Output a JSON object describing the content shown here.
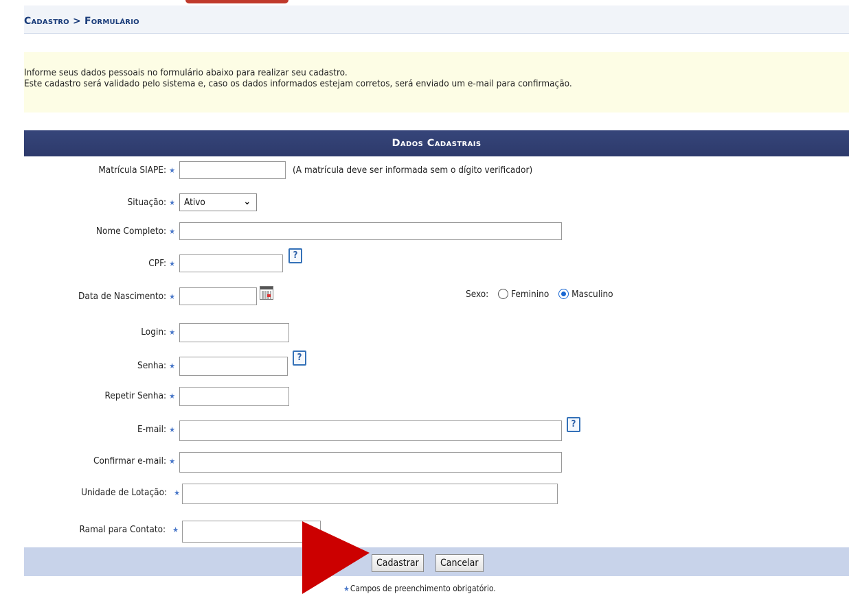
{
  "breadcrumb": "Cadastro > Formulário",
  "notice": {
    "line1": "Informe seus dados pessoais no formulário abaixo para realizar seu cadastro.",
    "line2": "Este cadastro será validado pelo sistema e, caso os dados informados estejam corretos, será enviado um e-mail para confirmação."
  },
  "form": {
    "title": "Dados Cadastrais",
    "required_marker": "★",
    "fields": {
      "matricula": {
        "label": "Matrícula SIAPE:",
        "value": "",
        "hint": "(A matrícula deve ser informada sem o dígito verificador)"
      },
      "situacao": {
        "label": "Situação:",
        "selected": "Ativo"
      },
      "nome": {
        "label": "Nome Completo:",
        "value": ""
      },
      "cpf": {
        "label": "CPF:",
        "value": ""
      },
      "nascimento": {
        "label": "Data de Nascimento:",
        "value": ""
      },
      "sexo": {
        "label": "Sexo:",
        "options": [
          "Feminino",
          "Masculino"
        ],
        "selected": "Masculino"
      },
      "login": {
        "label": "Login:",
        "value": ""
      },
      "senha": {
        "label": "Senha:",
        "value": ""
      },
      "repetir_senha": {
        "label": "Repetir Senha:",
        "value": ""
      },
      "email": {
        "label": "E-mail:",
        "value": ""
      },
      "confirmar_email": {
        "label": "Confirmar e-mail:",
        "value": ""
      },
      "unidade": {
        "label": "Unidade de Lotação:",
        "value": ""
      },
      "ramal": {
        "label": "Ramal para Contato:",
        "value": ""
      }
    },
    "help_icon_text": "?",
    "buttons": {
      "submit": "Cadastrar",
      "cancel": "Cancelar"
    },
    "mandatory_note": "Campos de preenchimento obrigatório."
  },
  "colors": {
    "header_bg": "#2d3a6b",
    "breadcrumb_text": "#1a3c7a",
    "notice_bg": "#fdfde5",
    "footer_bg": "#c8d3ea",
    "required_star": "#4a78c9",
    "annotation_arrow": "#cc0000"
  },
  "icons": [
    "help-icon",
    "calendar-icon",
    "chevron-down-icon",
    "required-star-icon",
    "pointer-arrow-icon"
  ]
}
